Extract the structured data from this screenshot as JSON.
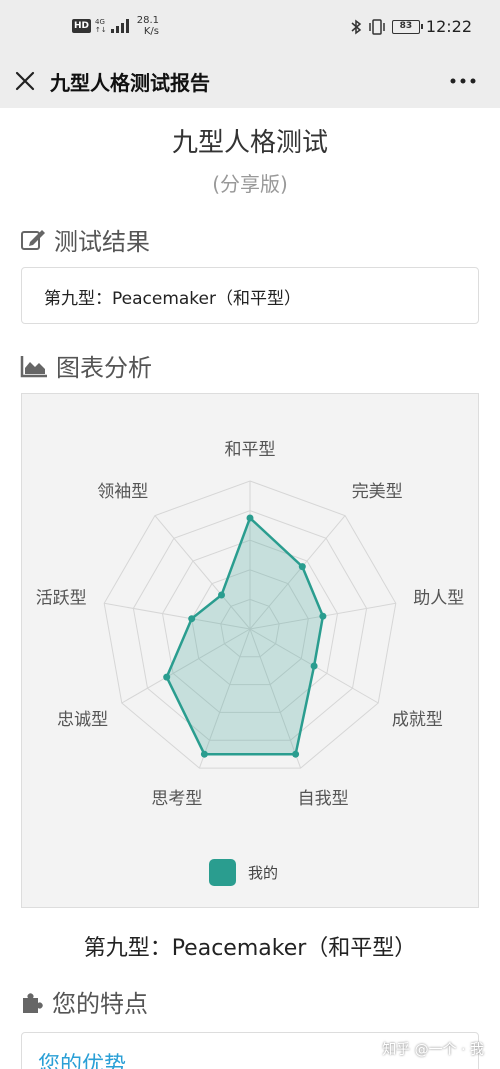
{
  "status_bar": {
    "hd": "HD",
    "network_top": "4G",
    "network_bottom": "↑↓",
    "speed_value": "28.1",
    "speed_unit": "K/s",
    "battery": "83",
    "time": "12:22"
  },
  "nav": {
    "title": "九型人格测试报告",
    "close_icon": "close-icon",
    "more_icon": "more-icon"
  },
  "page": {
    "title": "九型人格测试",
    "subtitle": "(分享版)"
  },
  "sections": {
    "result_label": "测试结果",
    "chart_label": "图表分析",
    "traits_label": "您的特点"
  },
  "result": {
    "text": "第九型：Peacemaker（和平型）"
  },
  "chart_data": {
    "type": "radar",
    "categories": [
      "和平型",
      "完美型",
      "助人型",
      "成就型",
      "自我型",
      "思考型",
      "忠诚型",
      "活跃型",
      "领袖型"
    ],
    "series": [
      {
        "name": "我的",
        "values": [
          0.75,
          0.55,
          0.5,
          0.5,
          0.9,
          0.9,
          0.65,
          0.4,
          0.3
        ]
      }
    ],
    "rmax": 1,
    "rings": 5,
    "legend": "bottom",
    "color": "#2a9d8f"
  },
  "caption": "第九型：Peacemaker（和平型）",
  "traits": {
    "heading": "您的优势"
  },
  "watermark": "知乎 @一个 · 我"
}
